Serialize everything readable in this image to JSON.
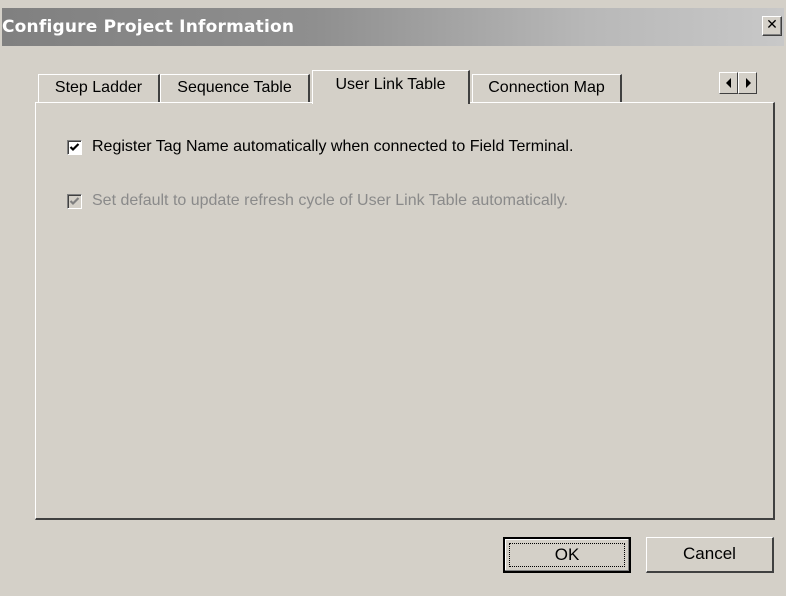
{
  "window": {
    "title": "Configure Project Information",
    "close_glyph": "✕"
  },
  "tabs": [
    {
      "label": "Step Ladder",
      "active": false
    },
    {
      "label": "Sequence Table",
      "active": false
    },
    {
      "label": "User Link Table",
      "active": true
    },
    {
      "label": "Connection Map",
      "active": false
    }
  ],
  "tab_scroll": {
    "left_icon": "left-triangle",
    "right_icon": "right-triangle"
  },
  "options": [
    {
      "label": "Register Tag Name automatically when connected to Field Terminal.",
      "checked": true,
      "enabled": true
    },
    {
      "label": "Set default to update refresh cycle of User Link Table automatically.",
      "checked": true,
      "enabled": false
    }
  ],
  "buttons": {
    "ok_label": "OK",
    "cancel_label": "Cancel"
  },
  "colors": {
    "face": "#d4d0c8",
    "disabled_text": "#8a8a8a"
  }
}
